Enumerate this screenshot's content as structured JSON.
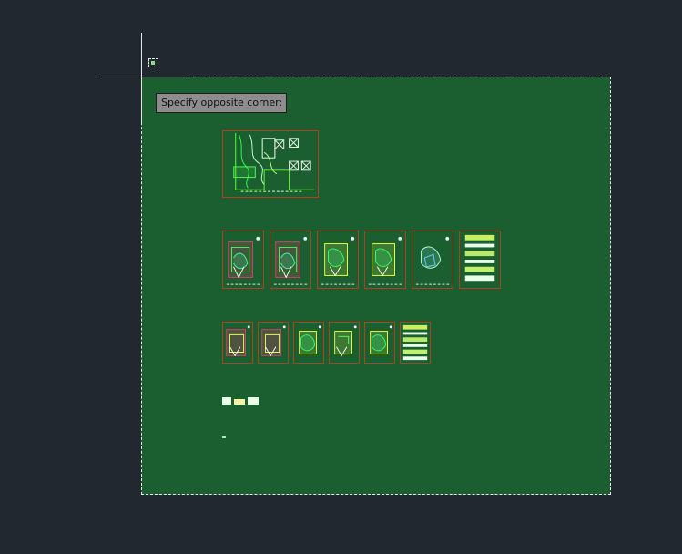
{
  "command_prompt": {
    "text": "Specify opposite corner:"
  },
  "colors": {
    "model_background": "#212830",
    "selection_fill": "#1b5e30",
    "sheet_border": "#b0401e",
    "crosshair": "#e6e6e6",
    "tooltip_bg": "#8d8d8d"
  },
  "icons": {
    "crosshair": "crosshair-cursor-icon",
    "pickbox": "pickbox-icon"
  }
}
